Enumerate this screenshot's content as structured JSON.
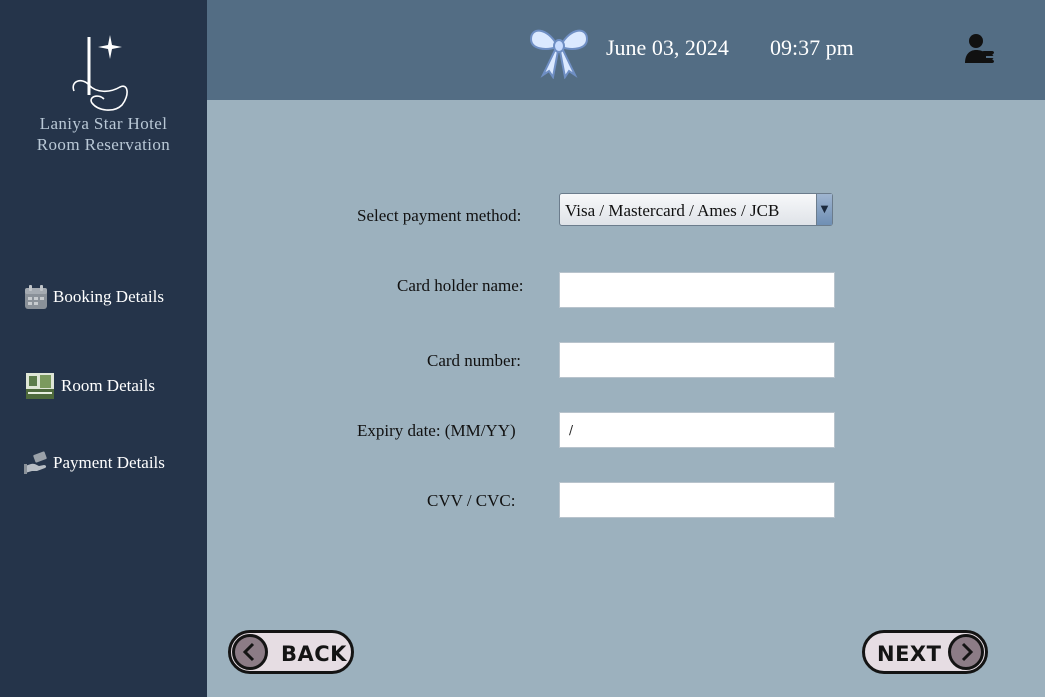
{
  "app": {
    "hotel_name": "Laniya Star Hotel",
    "subtitle": "Room Reservation",
    "logo_letter": "L"
  },
  "header": {
    "date": "June 03, 2024",
    "time": "09:37 pm",
    "decor_icon": "ribbon-bow-icon",
    "logout_icon": "user-logout-icon"
  },
  "sidebar": {
    "items": [
      {
        "label": "Booking Details",
        "icon": "calendar-icon"
      },
      {
        "label": "Room Details",
        "icon": "room-icon"
      },
      {
        "label": "Payment Details",
        "icon": "hand-money-icon"
      }
    ]
  },
  "form": {
    "payment_method": {
      "label": "Select payment method:",
      "value": "Visa / Mastercard / Ames / JCB"
    },
    "card_holder": {
      "label": "Card holder name:",
      "value": ""
    },
    "card_number": {
      "label": "Card number:",
      "value": ""
    },
    "expiry": {
      "label": "Expiry date: (MM/YY)",
      "value": "/"
    },
    "cvv": {
      "label": "CVV / CVC:",
      "value": ""
    }
  },
  "nav": {
    "back_label": "BACK",
    "next_label": "NEXT"
  },
  "colors": {
    "sidebar_bg": "#25344a",
    "header_bg": "#536d84",
    "content_bg": "#9cb1be",
    "button_bg": "#e6dde3"
  }
}
